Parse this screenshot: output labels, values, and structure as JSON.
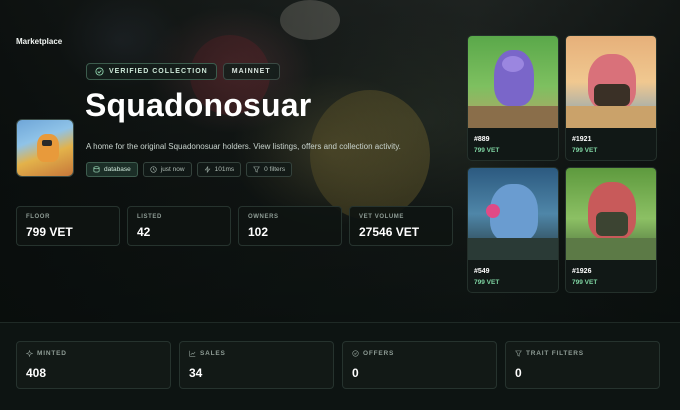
{
  "breadcrumb": "Marketplace",
  "badges": {
    "verified": "VERIFIED COLLECTION",
    "network": "MAINNET"
  },
  "collection": {
    "name": "Squadonosuar",
    "description": "A home for the original Squadonosuar holders. View listings, offers and collection activity."
  },
  "chips": {
    "source": "database",
    "updated": "just now",
    "latency": "101ms",
    "filters": "0 filters"
  },
  "stats": {
    "floor_label": "FLOOR",
    "floor_value": "799 VET",
    "listed_label": "LISTED",
    "listed_value": "42",
    "owners_label": "OWNERS",
    "owners_value": "102",
    "volume_label": "VET VOLUME",
    "volume_value": "27546 VET"
  },
  "stats2": {
    "minted_label": "MINTED",
    "minted_value": "408",
    "sales_label": "SALES",
    "sales_value": "34",
    "offers_label": "OFFERS",
    "offers_value": "0",
    "traits_label": "TRAIT FILTERS",
    "traits_value": "0"
  },
  "listings": [
    {
      "id": "#889",
      "price": "799 VET"
    },
    {
      "id": "#1921",
      "price": "799 VET"
    },
    {
      "id": "#549",
      "price": "799 VET"
    },
    {
      "id": "#1926",
      "price": "799 VET"
    }
  ],
  "colors": {
    "accent_green": "#7fd4a2",
    "background": "#0d1412",
    "card_border": "#24302b"
  },
  "icons": [
    "shield-check-icon",
    "database-icon",
    "clock-icon",
    "bolt-icon",
    "filter-icon",
    "sparkle-icon",
    "chart-icon",
    "circle-check-icon"
  ]
}
